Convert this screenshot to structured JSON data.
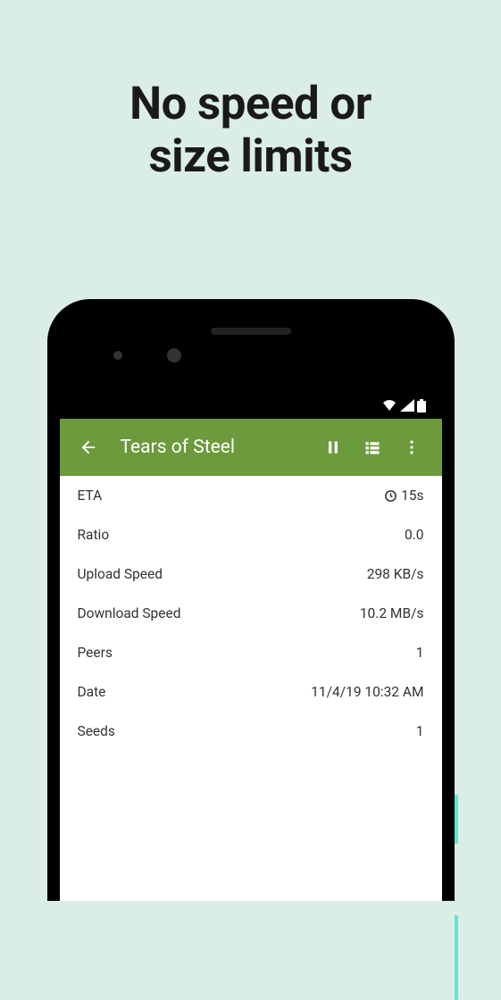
{
  "headline_line1": "No speed or",
  "headline_line2": "size limits",
  "appbar": {
    "title": "Tears of Steel"
  },
  "rows": [
    {
      "label": "ETA",
      "value": "15s",
      "hasClockIcon": true
    },
    {
      "label": "Ratio",
      "value": "0.0"
    },
    {
      "label": "Upload Speed",
      "value": "298 KB/s"
    },
    {
      "label": "Download Speed",
      "value": "10.2 MB/s"
    },
    {
      "label": "Peers",
      "value": "1"
    },
    {
      "label": "Date",
      "value": "11/4/19 10:32 AM"
    },
    {
      "label": "Seeds",
      "value": "1"
    }
  ]
}
